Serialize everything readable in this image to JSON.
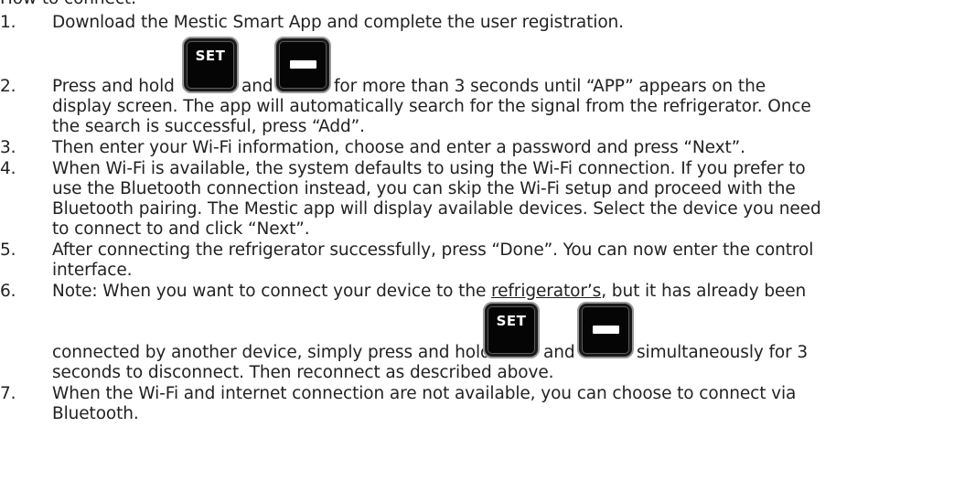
{
  "heading": "How to connect:",
  "steps": [
    {
      "number": "1.",
      "lines": [
        "Download the Mestic Smart App and complete the user registration."
      ]
    },
    {
      "number": "2.",
      "line1_before": "Press and hold",
      "line1_mid": "and",
      "line1_after": "for more than 3 seconds until “APP” appears on the",
      "lines": [
        "display screen. The app will automatically search for the signal from the refrigerator. Once",
        "the search is successful, press “Add”."
      ]
    },
    {
      "number": "3.",
      "lines": [
        "Then enter your Wi-Fi information, choose and enter a password and press “Next”."
      ]
    },
    {
      "number": "4.",
      "lines": [
        "When Wi-Fi is available, the system defaults to using the Wi-Fi connection. If you prefer to",
        "use the Bluetooth connection instead, you can skip the Wi-Fi setup and proceed with the",
        "Bluetooth pairing. The Mestic app will display available devices. Select the device you need",
        "to connect to and click “Next”."
      ]
    },
    {
      "number": "5.",
      "lines": [
        "After connecting the refrigerator successfully, press “Done”. You can now enter the control",
        "interface."
      ]
    },
    {
      "number": "6.",
      "line1_before": "Note: When you want to connect your device to the",
      "line1_underlined": "refrigerator’s",
      "line1_after": ", but it has already been",
      "line2_before": "connected by another device, simply press and hold",
      "line2_mid": "and",
      "line2_after": "simultaneously for 3",
      "line3": "seconds to disconnect. Then reconnect as described above."
    },
    {
      "number": "7.",
      "lines": [
        "When the Wi-Fi and internet connection are not available, you can choose to connect via",
        "Bluetooth."
      ]
    }
  ],
  "icons": {
    "set_key_label": "SET",
    "set_key_icon": "set-button-icon",
    "minus_key_icon": "minus-button-icon"
  }
}
